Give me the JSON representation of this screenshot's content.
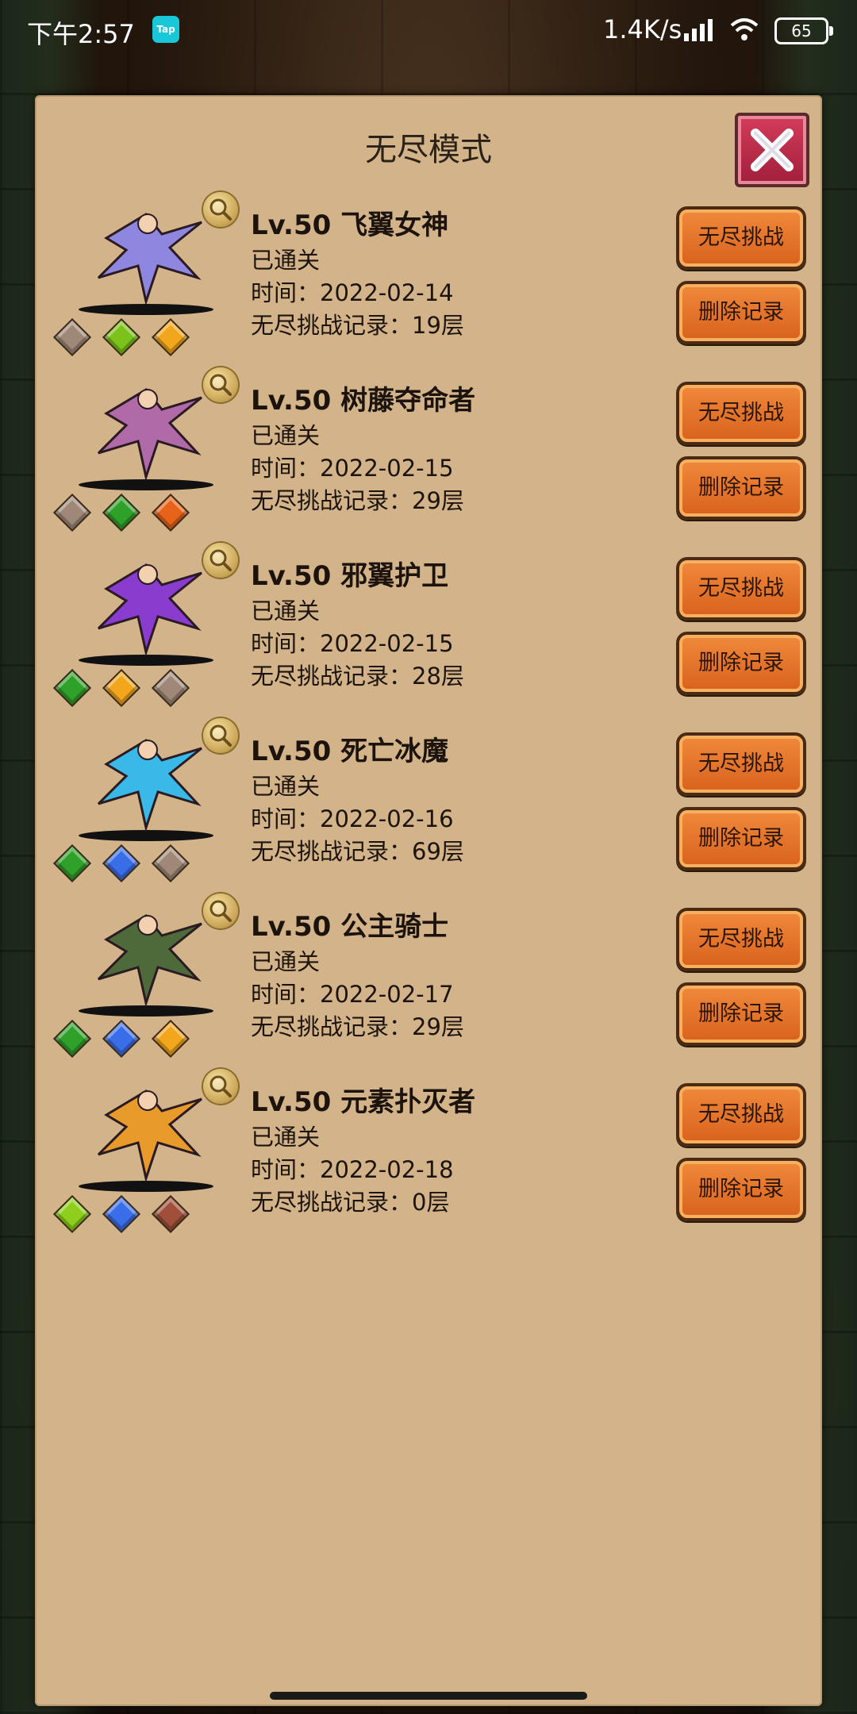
{
  "status_bar": {
    "time": "下午2:57",
    "app_badge": "Tap",
    "net_speed": "1.4K/s",
    "battery": "65"
  },
  "dialog": {
    "title": "无尽模式"
  },
  "buttons": {
    "challenge_label": "无尽挑战",
    "delete_label": "删除记录"
  },
  "entries": [
    {
      "name": "Lv.50 飞翼女神",
      "status": "已通关",
      "time": "时间：2022-02-14",
      "record": "无尽挑战记录：19层",
      "gems": [
        "#a08878",
        "#7bc31a",
        "#f2a61c"
      ],
      "accent": "#8f86e0"
    },
    {
      "name": "Lv.50 树藤夺命者",
      "status": "已通关",
      "time": "时间：2022-02-15",
      "record": "无尽挑战记录：29层",
      "gems": [
        "#a08878",
        "#2fa12a",
        "#e8631a"
      ],
      "accent": "#b06aa8"
    },
    {
      "name": "Lv.50 邪翼护卫",
      "status": "已通关",
      "time": "时间：2022-02-15",
      "record": "无尽挑战记录：28层",
      "gems": [
        "#2fa12a",
        "#f2a61c",
        "#a08878"
      ],
      "accent": "#8a3ccf"
    },
    {
      "name": "Lv.50 死亡冰魔",
      "status": "已通关",
      "time": "时间：2022-02-16",
      "record": "无尽挑战记录：69层",
      "gems": [
        "#2fa12a",
        "#3a6ee8",
        "#a08878"
      ],
      "accent": "#3ab8e8"
    },
    {
      "name": "Lv.50 公主骑士",
      "status": "已通关",
      "time": "时间：2022-02-17",
      "record": "无尽挑战记录：29层",
      "gems": [
        "#2fa12a",
        "#3a6ee8",
        "#f2a61c"
      ],
      "accent": "#4f6a3a"
    },
    {
      "name": "Lv.50 元素扑灭者",
      "status": "已通关",
      "time": "时间：2022-02-18",
      "record": "无尽挑战记录：0层",
      "gems": [
        "#8dcf1c",
        "#3a6ee8",
        "#a0503a"
      ],
      "accent": "#e89a2a"
    }
  ]
}
